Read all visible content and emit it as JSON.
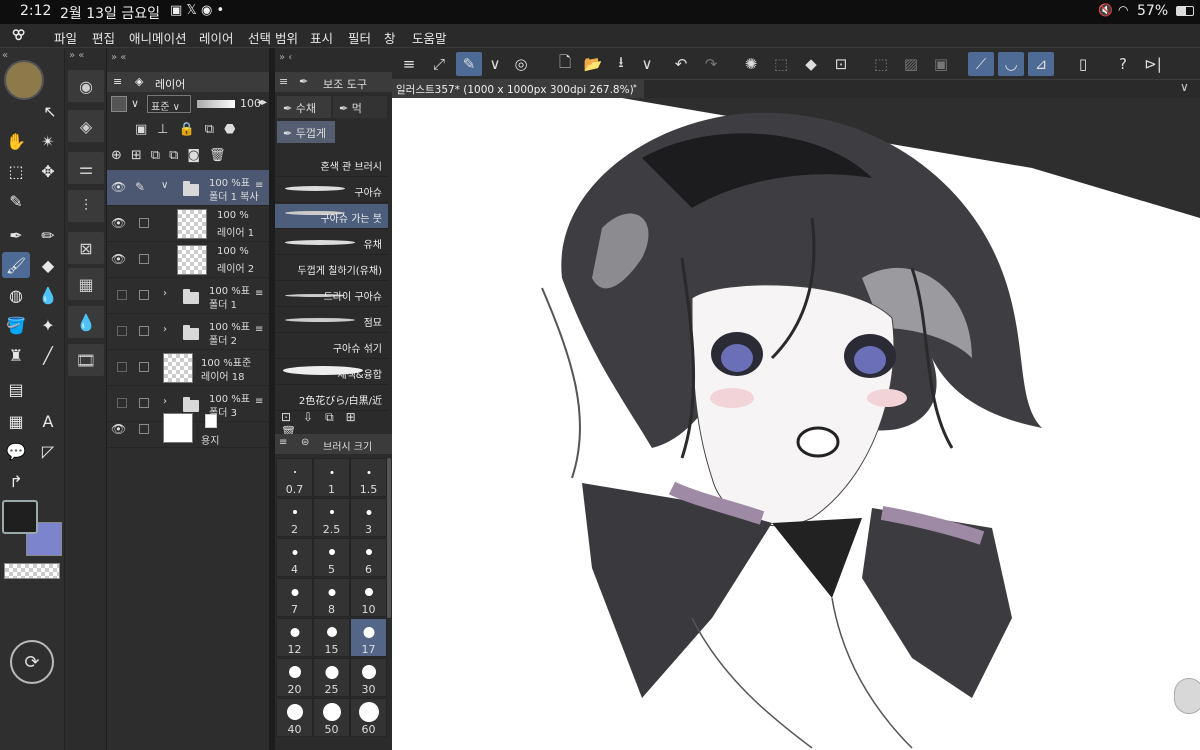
{
  "status": {
    "time": "2:12",
    "date": "2월 13일 금요일",
    "battery": "57%"
  },
  "menu": [
    "파일",
    "편집",
    "애니메이션",
    "레이어",
    "선택 범위",
    "표시",
    "필터",
    "창",
    "도움말"
  ],
  "layers": {
    "panel_title": "레이어",
    "blend_mode": "표준",
    "opacity_value": "100",
    "rows": [
      {
        "pct": "100 %표",
        "name": "폴더 1 복사"
      },
      {
        "pct": "100 %",
        "name": "레이어 1"
      },
      {
        "pct": "100 %",
        "name": "레이어 2"
      },
      {
        "pct": "100 %표",
        "name": "폴더 1"
      },
      {
        "pct": "100 %표",
        "name": "폴더 2"
      },
      {
        "pct": "100 %표준",
        "name": "레이어 18"
      },
      {
        "pct": "100 %표",
        "name": "폴더 3"
      },
      {
        "pct": "",
        "name": "용지"
      }
    ]
  },
  "subtool": {
    "panel_title": "보조 도구",
    "tabs": [
      "수채",
      "먹",
      "두껍게"
    ],
    "brushes": [
      "혼색 관 브러시",
      "구아슈",
      "구아슈 가는 붓",
      "유채",
      "두껍게 칠하기(유채)",
      "드라이 구아슈",
      "점묘",
      "구아슈 섞기",
      "채색&융합",
      "2色花びら/白黒/近"
    ]
  },
  "brush_size": {
    "panel_title": "브러시 크기",
    "sizes": [
      "0.7",
      "1",
      "1.5",
      "2",
      "2.5",
      "3",
      "4",
      "5",
      "6",
      "7",
      "8",
      "10",
      "12",
      "15",
      "17",
      "20",
      "25",
      "30",
      "40",
      "50",
      "60"
    ],
    "selected": "17"
  },
  "document": {
    "tab_title": "일러스트357* (1000 x 1000px 300dpi 267.8%)"
  },
  "colors": {
    "main": "#1f1f1f",
    "sub": "#7b84cc",
    "accent": "#4d6b94"
  }
}
